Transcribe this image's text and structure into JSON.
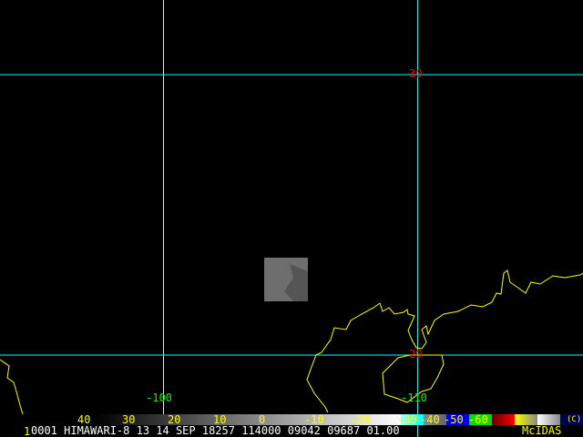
{
  "satellite_image": {
    "grid": {
      "latitudes": [
        {
          "label": "30"
        },
        {
          "label": "20"
        }
      ],
      "longitudes": [
        {
          "label": "-100"
        },
        {
          "label": "-110"
        }
      ],
      "grid_color": "#00ffff",
      "lat_label_color": "#ff0000",
      "lon_label_color": "#00ff00",
      "coastline_color": "#ffff00"
    }
  },
  "colorbar": {
    "labels": [
      "40",
      "30",
      "20",
      "10",
      "0",
      "-10",
      "-20",
      "-30",
      "-40",
      "-50",
      "-60"
    ],
    "copyright": "(C)"
  },
  "info_line": {
    "frame": "1",
    "text": "0001 HIMAWARI-8 13 14 SEP 18257 114000 09042 09687 01.00",
    "brand": "McIDAS"
  }
}
